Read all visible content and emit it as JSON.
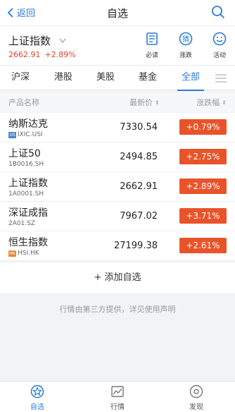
{
  "nav": {
    "back_label": "返回",
    "title": "自选"
  },
  "summary": {
    "name": "上证指数",
    "price": "2662.91",
    "change": "+2.89%",
    "actions": [
      {
        "label": "必读",
        "icon": "document-icon"
      },
      {
        "label": "涨跌",
        "icon": "guess-icon",
        "glyph": "猜"
      },
      {
        "label": "活动",
        "icon": "smile-icon"
      }
    ]
  },
  "tabs": [
    {
      "label": "沪深"
    },
    {
      "label": "港股"
    },
    {
      "label": "美股"
    },
    {
      "label": "基金"
    },
    {
      "label": "全部",
      "active": true
    }
  ],
  "columns": {
    "name": "产品名称",
    "price": "最新价",
    "change": "涨跌幅",
    "sort_glyph": "⬍"
  },
  "rows": [
    {
      "name": "纳斯达克",
      "market": "US",
      "market_color": "#4a86c9",
      "code": "IXIC.USI",
      "price": "7330.54",
      "change": "+0.79%"
    },
    {
      "name": "上证50",
      "market": "",
      "code": "1B0016.SH",
      "price": "2494.85",
      "change": "+2.75%"
    },
    {
      "name": "上证指数",
      "market": "",
      "code": "1A0001.SH",
      "price": "2662.91",
      "change": "+2.89%"
    },
    {
      "name": "深证成指",
      "market": "",
      "code": "2A01.SZ",
      "price": "7967.02",
      "change": "+3.71%"
    },
    {
      "name": "恒生指数",
      "market": "HK",
      "market_color": "#e08a3a",
      "code": "HSI.HK",
      "price": "27199.38",
      "change": "+2.61%"
    }
  ],
  "add_label": "+ 添加自选",
  "disclaimer": "行情由第三方提供，详见使用声明",
  "bottom_nav": [
    {
      "label": "自选",
      "icon": "star-icon",
      "active": true
    },
    {
      "label": "行情",
      "icon": "chart-icon"
    },
    {
      "label": "发现",
      "icon": "compass-icon"
    }
  ],
  "colors": {
    "accent": "#2a7bd6",
    "up": "#e0432c",
    "up_badge": "#e8532a"
  }
}
